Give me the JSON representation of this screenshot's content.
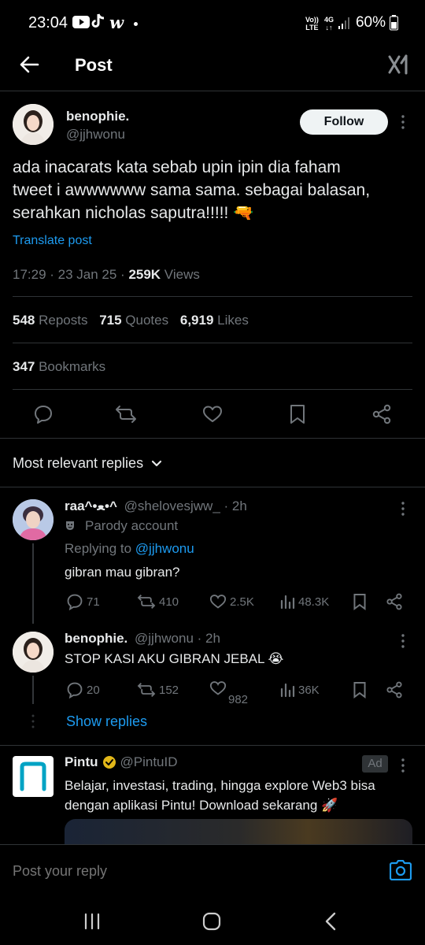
{
  "status_bar": {
    "time": "23:04",
    "indicators": [
      "youtube-icon",
      "tiktok-icon",
      "webtoon-icon",
      "dot"
    ],
    "network_labels": [
      "Vo)) LTE",
      "4G"
    ],
    "battery": "60%"
  },
  "header": {
    "title": "Post",
    "back_icon": "back-arrow-icon",
    "brand_icon": "xai-grok-icon"
  },
  "post": {
    "author_name": "benophie.",
    "author_handle": "@jjhwonu",
    "follow_label": "Follow",
    "text_line1": "ada inacarats kata sebab upin ipin dia faham",
    "text_line2": "tweet i awwwwww sama sama. sebagai balasan,",
    "text_line3": "serahkan nicholas saputra!!!!! 🔫",
    "translate_label": "Translate post",
    "timestamp": "17:29 · 23 Jan 25 · ",
    "views_count": "259K",
    "views_label": " Views",
    "reposts_count": "548",
    "reposts_label": " Reposts",
    "quotes_count": "715",
    "quotes_label": " Quotes",
    "likes_count": "6,919",
    "likes_label": " Likes",
    "bookmarks_count": "347",
    "bookmarks_label": " Bookmarks"
  },
  "replies_filter": "Most relevant replies",
  "replies": [
    {
      "name": "raa^•ﻌ•^",
      "handle": "@shelovesjww_ · 2h",
      "parody_label": "Parody account",
      "replying_prefix": "Replying to ",
      "replying_handle": "@jjhwonu",
      "text": "gibran mau gibran?",
      "replies": "71",
      "reposts": "410",
      "likes": "2.5K",
      "views": "48.3K"
    },
    {
      "name": "benophie.",
      "handle": "@jjhwonu · 2h",
      "text": "STOP KASI AKU GIBRAN JEBAL 😭",
      "replies": "20",
      "reposts": "152",
      "likes": "982",
      "views": "36K"
    }
  ],
  "show_replies": "Show replies",
  "ad": {
    "name": "Pintu",
    "handle": "@PintuID",
    "badge": "Ad",
    "text_line1": "Belajar, investasi, trading, hingga explore Web3 bisa",
    "text_line2": "dengan aplikasi Pintu! Download sekarang 🚀"
  },
  "reply_input": {
    "placeholder": "Post your reply"
  },
  "colors": {
    "background": "#000000",
    "text": "#e7e9ea",
    "muted": "#71767b",
    "link": "#1d9bf0",
    "divider": "#2f3336",
    "gold_check": "#e2b719"
  }
}
